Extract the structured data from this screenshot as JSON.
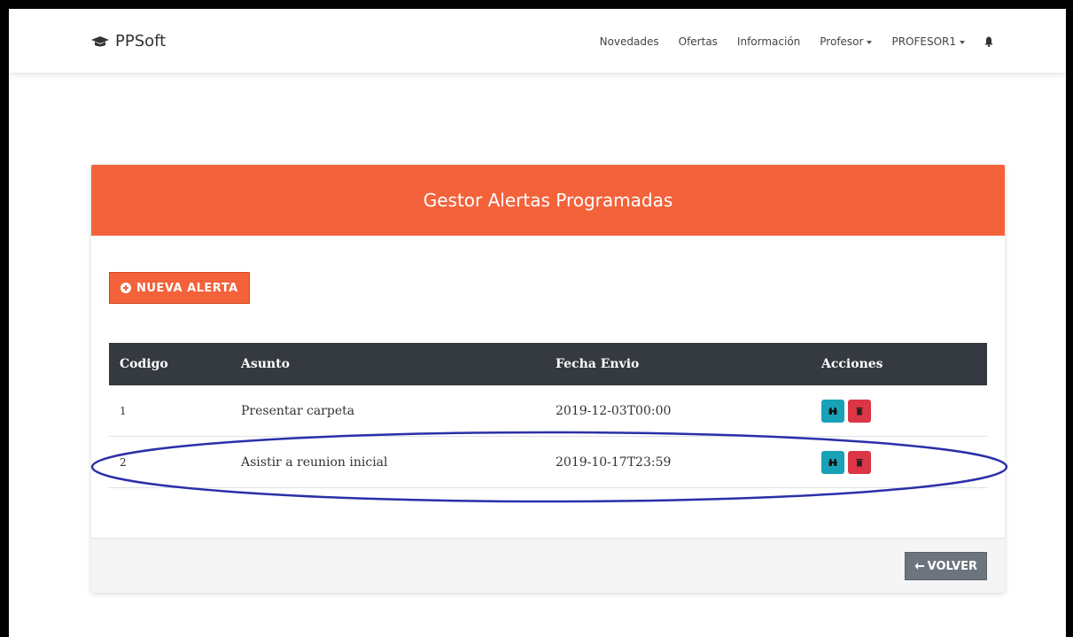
{
  "navbar": {
    "brand": "PPSoft",
    "items": [
      "Novedades",
      "Ofertas",
      "Información"
    ],
    "profesor": "Profesor",
    "user": "PROFESOR1"
  },
  "card": {
    "title": "Gestor Alertas Programadas",
    "new_button": "NUEVA ALERTA",
    "back_button": "VOLVER"
  },
  "table": {
    "headers": [
      "Codigo",
      "Asunto",
      "Fecha Envio",
      "Acciones"
    ],
    "rows": [
      {
        "codigo": "1",
        "asunto": "Presentar carpeta",
        "fecha": "2019-12-03T00:00"
      },
      {
        "codigo": "2",
        "asunto": "Asistir a reunion inicial",
        "fecha": "2019-10-17T23:59"
      }
    ]
  },
  "colors": {
    "accent": "#f3623a",
    "table_header": "#343a40",
    "view_button": "#17a2b8",
    "delete_button": "#dc3545",
    "back_button": "#6c757d",
    "annotation": "#2b2fa8"
  },
  "icons": {
    "brand": "graduation-cap-icon",
    "new": "plus-circle-icon",
    "view": "binoculars-icon",
    "delete": "trash-icon",
    "back": "arrow-left-icon",
    "notifications": "bell-icon"
  }
}
